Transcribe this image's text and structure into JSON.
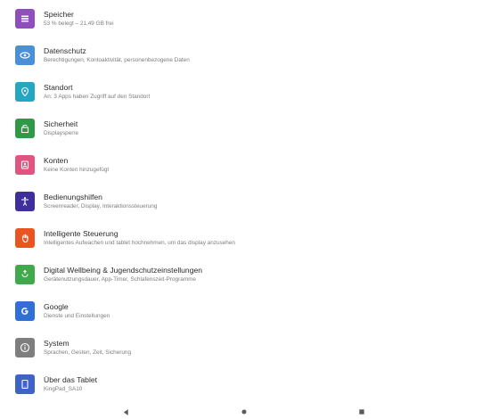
{
  "settings": {
    "items": [
      {
        "title": "Speicher",
        "subtitle": "53 % belegt – 21,49 GB frei",
        "icon": "storage-icon",
        "color": "#8e4fbd"
      },
      {
        "title": "Datenschutz",
        "subtitle": "Berechtigungen, Kontoaktivität, personenbezogene Daten",
        "icon": "privacy-eye-icon",
        "color": "#4a90d9"
      },
      {
        "title": "Standort",
        "subtitle": "An: 3 Apps haben Zugriff auf den Standort",
        "icon": "location-pin-icon",
        "color": "#26a6c2"
      },
      {
        "title": "Sicherheit",
        "subtitle": "Displaysperre",
        "icon": "lock-icon",
        "color": "#2e9a48"
      },
      {
        "title": "Konten",
        "subtitle": "Keine Konten hinzugefügt",
        "icon": "accounts-icon",
        "color": "#e0557f"
      },
      {
        "title": "Bedienungshilfen",
        "subtitle": "Screenreader, Display, Interaktionssteuerung",
        "icon": "accessibility-icon",
        "color": "#3f2f9e"
      },
      {
        "title": "Intelligente Steuerung",
        "subtitle": "Intelligentes Aufwachen und tablet hochnehmen, um das display anzusehen",
        "icon": "hand-gesture-icon",
        "color": "#ea5420"
      },
      {
        "title": "Digital Wellbeing & Jugendschutzeinstellungen",
        "subtitle": "Gerätenutzungsdauer, App-Timer, Schlafenszeit-Programme",
        "icon": "wellbeing-icon",
        "color": "#3fa94c"
      },
      {
        "title": "Google",
        "subtitle": "Dienste und Einstellungen",
        "icon": "google-icon",
        "color": "#2f6fd6"
      },
      {
        "title": "System",
        "subtitle": "Sprachen, Gesten, Zeit, Sicherung",
        "icon": "info-icon",
        "color": "#7e7e7e"
      },
      {
        "title": "Über das Tablet",
        "subtitle": "KingPad_SA10",
        "icon": "tablet-icon",
        "color": "#3f63c4"
      }
    ]
  },
  "navbar": {
    "icons": [
      "back-icon",
      "home-icon",
      "recents-icon"
    ],
    "color": "#5a5a5a"
  }
}
